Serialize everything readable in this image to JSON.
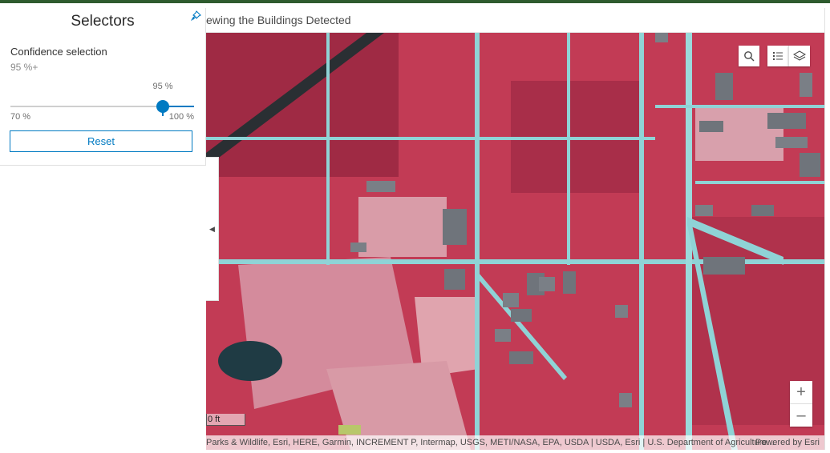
{
  "app": {
    "header_title": "ewing the Buildings Detected"
  },
  "panel": {
    "title": "Selectors",
    "pin_icon": "pin-icon",
    "confidence_label": "Confidence selection",
    "confidence_value": "95 %+",
    "slider": {
      "current_label": "95 %",
      "value": 95,
      "min": 70,
      "max": 100,
      "min_label": "70 %",
      "max_label": "100 %"
    },
    "reset_label": "Reset"
  },
  "map": {
    "scale_label": "0 ft",
    "attribution": "Parks & Wildlife, Esri, HERE, Garmin, INCREMENT P, Intermap, USGS, METI/NASA, EPA, USDA | USDA, Esri | U.S. Department of Agriculture...",
    "powered_by": "Powered by Esri",
    "tools": [
      "search-icon",
      "legend-icon",
      "layers-icon"
    ],
    "zoom_in_label": "+",
    "zoom_out_label": "–"
  },
  "colors": {
    "accent": "#007ac2",
    "topbar": "#2e5b2e",
    "vegetation": "#c23b55",
    "roads": "#8fd3d6"
  }
}
